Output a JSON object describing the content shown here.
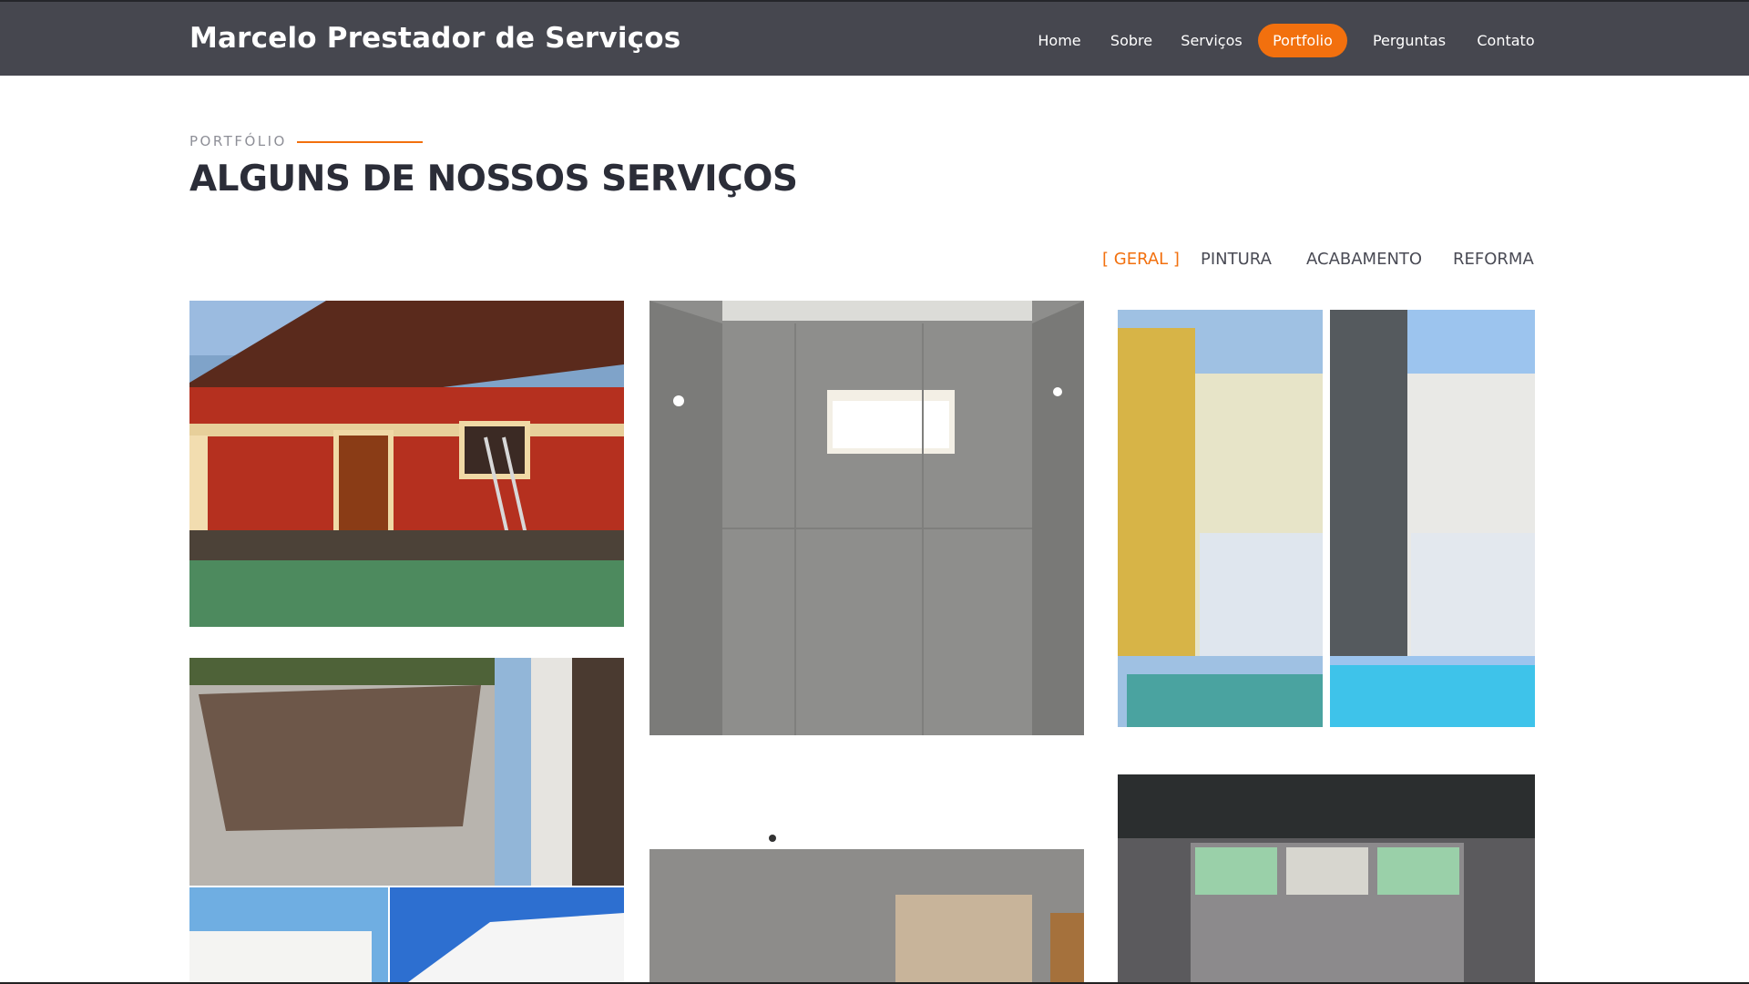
{
  "header": {
    "brand": "Marcelo Prestador de Serviços",
    "nav": [
      {
        "label": "Home",
        "active": false
      },
      {
        "label": "Sobre",
        "active": false
      },
      {
        "label": "Serviços",
        "active": false
      },
      {
        "label": "Portfolio",
        "active": true
      },
      {
        "label": "Perguntas",
        "active": false
      },
      {
        "label": "Contato",
        "active": false
      }
    ]
  },
  "section": {
    "eyebrow": "PORTFÓLIO",
    "title": "ALGUNS DE NOSSOS SERVIÇOS"
  },
  "filters": [
    {
      "label": "[ GERAL ]",
      "active": true
    },
    {
      "label": "PINTURA",
      "active": false
    },
    {
      "label": "ACABAMENTO",
      "active": false
    },
    {
      "label": "REFORMA",
      "active": false
    }
  ],
  "gallery": [
    {
      "name": "red-brick-house-photo"
    },
    {
      "name": "concrete-wall-window-photo"
    },
    {
      "name": "house-pool-before-after-photo"
    },
    {
      "name": "deck-facade-collage-photo"
    },
    {
      "name": "interior-ceiling-photo"
    },
    {
      "name": "warehouse-stained-glass-photo"
    }
  ],
  "colors": {
    "header_bg": "#46474f",
    "accent": "#f2700e",
    "title": "#2b2d38"
  }
}
